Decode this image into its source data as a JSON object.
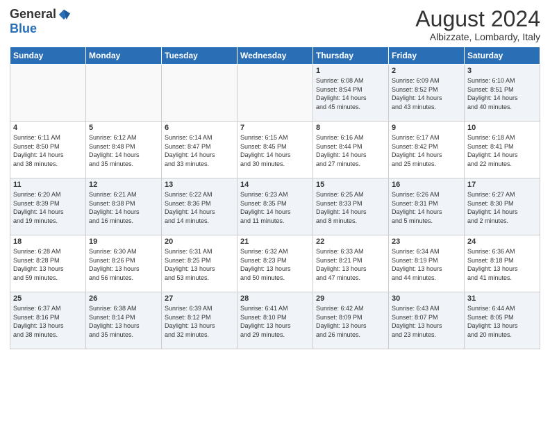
{
  "logo": {
    "general": "General",
    "blue": "Blue"
  },
  "title": "August 2024",
  "subtitle": "Albizzate, Lombardy, Italy",
  "days_header": [
    "Sunday",
    "Monday",
    "Tuesday",
    "Wednesday",
    "Thursday",
    "Friday",
    "Saturday"
  ],
  "weeks": [
    [
      {
        "day": "",
        "info": ""
      },
      {
        "day": "",
        "info": ""
      },
      {
        "day": "",
        "info": ""
      },
      {
        "day": "",
        "info": ""
      },
      {
        "day": "1",
        "info": "Sunrise: 6:08 AM\nSunset: 8:54 PM\nDaylight: 14 hours\nand 45 minutes."
      },
      {
        "day": "2",
        "info": "Sunrise: 6:09 AM\nSunset: 8:52 PM\nDaylight: 14 hours\nand 43 minutes."
      },
      {
        "day": "3",
        "info": "Sunrise: 6:10 AM\nSunset: 8:51 PM\nDaylight: 14 hours\nand 40 minutes."
      }
    ],
    [
      {
        "day": "4",
        "info": "Sunrise: 6:11 AM\nSunset: 8:50 PM\nDaylight: 14 hours\nand 38 minutes."
      },
      {
        "day": "5",
        "info": "Sunrise: 6:12 AM\nSunset: 8:48 PM\nDaylight: 14 hours\nand 35 minutes."
      },
      {
        "day": "6",
        "info": "Sunrise: 6:14 AM\nSunset: 8:47 PM\nDaylight: 14 hours\nand 33 minutes."
      },
      {
        "day": "7",
        "info": "Sunrise: 6:15 AM\nSunset: 8:45 PM\nDaylight: 14 hours\nand 30 minutes."
      },
      {
        "day": "8",
        "info": "Sunrise: 6:16 AM\nSunset: 8:44 PM\nDaylight: 14 hours\nand 27 minutes."
      },
      {
        "day": "9",
        "info": "Sunrise: 6:17 AM\nSunset: 8:42 PM\nDaylight: 14 hours\nand 25 minutes."
      },
      {
        "day": "10",
        "info": "Sunrise: 6:18 AM\nSunset: 8:41 PM\nDaylight: 14 hours\nand 22 minutes."
      }
    ],
    [
      {
        "day": "11",
        "info": "Sunrise: 6:20 AM\nSunset: 8:39 PM\nDaylight: 14 hours\nand 19 minutes."
      },
      {
        "day": "12",
        "info": "Sunrise: 6:21 AM\nSunset: 8:38 PM\nDaylight: 14 hours\nand 16 minutes."
      },
      {
        "day": "13",
        "info": "Sunrise: 6:22 AM\nSunset: 8:36 PM\nDaylight: 14 hours\nand 14 minutes."
      },
      {
        "day": "14",
        "info": "Sunrise: 6:23 AM\nSunset: 8:35 PM\nDaylight: 14 hours\nand 11 minutes."
      },
      {
        "day": "15",
        "info": "Sunrise: 6:25 AM\nSunset: 8:33 PM\nDaylight: 14 hours\nand 8 minutes."
      },
      {
        "day": "16",
        "info": "Sunrise: 6:26 AM\nSunset: 8:31 PM\nDaylight: 14 hours\nand 5 minutes."
      },
      {
        "day": "17",
        "info": "Sunrise: 6:27 AM\nSunset: 8:30 PM\nDaylight: 14 hours\nand 2 minutes."
      }
    ],
    [
      {
        "day": "18",
        "info": "Sunrise: 6:28 AM\nSunset: 8:28 PM\nDaylight: 13 hours\nand 59 minutes."
      },
      {
        "day": "19",
        "info": "Sunrise: 6:30 AM\nSunset: 8:26 PM\nDaylight: 13 hours\nand 56 minutes."
      },
      {
        "day": "20",
        "info": "Sunrise: 6:31 AM\nSunset: 8:25 PM\nDaylight: 13 hours\nand 53 minutes."
      },
      {
        "day": "21",
        "info": "Sunrise: 6:32 AM\nSunset: 8:23 PM\nDaylight: 13 hours\nand 50 minutes."
      },
      {
        "day": "22",
        "info": "Sunrise: 6:33 AM\nSunset: 8:21 PM\nDaylight: 13 hours\nand 47 minutes."
      },
      {
        "day": "23",
        "info": "Sunrise: 6:34 AM\nSunset: 8:19 PM\nDaylight: 13 hours\nand 44 minutes."
      },
      {
        "day": "24",
        "info": "Sunrise: 6:36 AM\nSunset: 8:18 PM\nDaylight: 13 hours\nand 41 minutes."
      }
    ],
    [
      {
        "day": "25",
        "info": "Sunrise: 6:37 AM\nSunset: 8:16 PM\nDaylight: 13 hours\nand 38 minutes."
      },
      {
        "day": "26",
        "info": "Sunrise: 6:38 AM\nSunset: 8:14 PM\nDaylight: 13 hours\nand 35 minutes."
      },
      {
        "day": "27",
        "info": "Sunrise: 6:39 AM\nSunset: 8:12 PM\nDaylight: 13 hours\nand 32 minutes."
      },
      {
        "day": "28",
        "info": "Sunrise: 6:41 AM\nSunset: 8:10 PM\nDaylight: 13 hours\nand 29 minutes."
      },
      {
        "day": "29",
        "info": "Sunrise: 6:42 AM\nSunset: 8:09 PM\nDaylight: 13 hours\nand 26 minutes."
      },
      {
        "day": "30",
        "info": "Sunrise: 6:43 AM\nSunset: 8:07 PM\nDaylight: 13 hours\nand 23 minutes."
      },
      {
        "day": "31",
        "info": "Sunrise: 6:44 AM\nSunset: 8:05 PM\nDaylight: 13 hours\nand 20 minutes."
      }
    ]
  ]
}
